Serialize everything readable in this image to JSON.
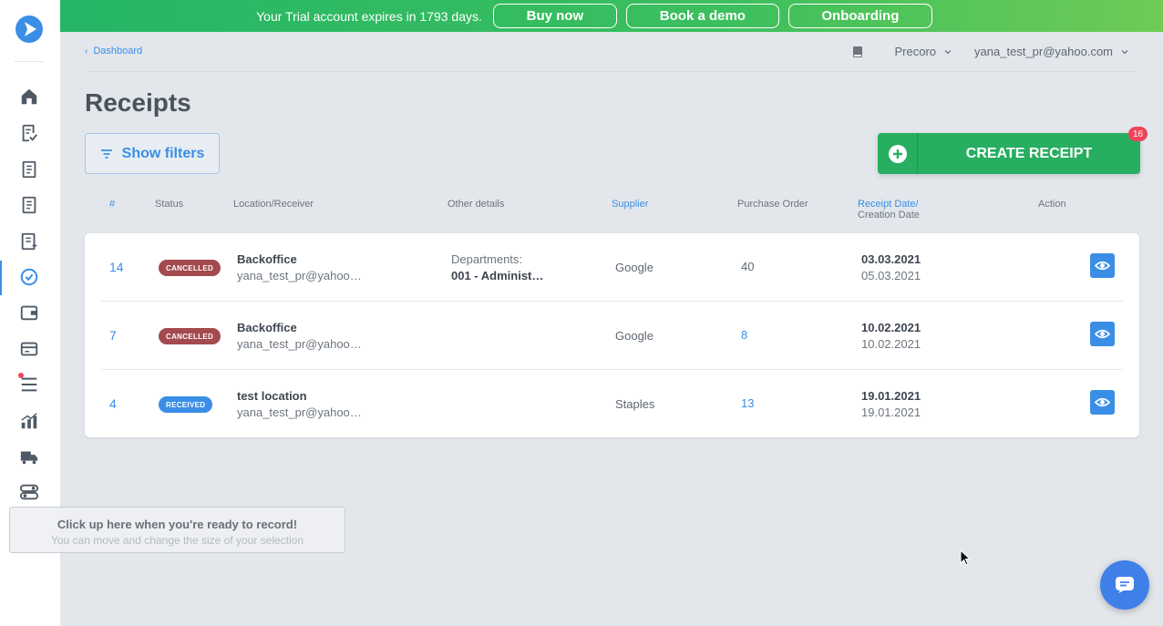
{
  "banner": {
    "text": "Your Trial account expires in 1793 days.",
    "buy_label": "Buy now",
    "demo_label": "Book a demo",
    "onboarding_label": "Onboarding"
  },
  "sidebar": {
    "items": [
      "home-icon",
      "receipt-check-icon",
      "document-icon",
      "document-icon",
      "invoice-icon",
      "check-circle-icon",
      "wallet-icon",
      "card-icon",
      "list-icon",
      "chart-icon",
      "truck-icon",
      "toggle-icon"
    ],
    "active": "check-circle-icon"
  },
  "breadcrumb": {
    "label": "Dashboard"
  },
  "topbar": {
    "company": "Precoro",
    "user": "yana_test_pr@yahoo.com"
  },
  "page": {
    "title": "Receipts",
    "filters_label": "Show filters",
    "create_label": "CREATE RECEIPT",
    "create_badge": "16"
  },
  "table": {
    "headers": {
      "num": "#",
      "status": "Status",
      "location": "Location/Receiver",
      "other": "Other details",
      "supplier": "Supplier",
      "po": "Purchase Order",
      "date1": "Receipt Date/",
      "date2": "Creation Date",
      "action": "Action"
    },
    "rows": [
      {
        "num": "14",
        "status": "CANCELLED",
        "status_color": "#a34a4e",
        "location": "Backoffice",
        "receiver": "yana_test_pr@yahoo…",
        "other_label": "Departments:",
        "other_value": "001 - Administ…",
        "supplier": "Google",
        "po": "40",
        "receipt_date": "03.03.2021",
        "creation_date": "05.03.2021"
      },
      {
        "num": "7",
        "status": "CANCELLED",
        "status_color": "#a34a4e",
        "location": "Backoffice",
        "receiver": "yana_test_pr@yahoo…",
        "other_label": "",
        "other_value": "",
        "supplier": "Google",
        "po": "8",
        "receipt_date": "10.02.2021",
        "creation_date": "10.02.2021"
      },
      {
        "num": "4",
        "status": "RECEIVED",
        "status_color": "#3a8ee6",
        "location": "test location",
        "receiver": "yana_test_pr@yahoo…",
        "other_label": "",
        "other_value": "",
        "supplier": "Staples",
        "po": "13",
        "receipt_date": "19.01.2021",
        "creation_date": "19.01.2021"
      }
    ]
  },
  "recorder": {
    "title": "Click up here when you're ready to record!",
    "subtitle": "You can move and change the size of your selection"
  },
  "colors": {
    "accent": "#3a8ee6",
    "green": "#27ae60",
    "badge": "#f0445a"
  }
}
